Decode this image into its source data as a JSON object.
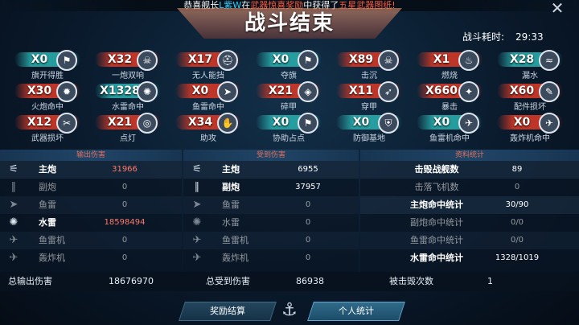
{
  "banner": {
    "p1": "恭喜舰长",
    "player": "L紫W",
    "p2": "在",
    "event": "武器惊喜奖励",
    "p3": "中获得了",
    "item": "五星武器图纸!"
  },
  "title": "战斗结束",
  "timer": {
    "label": "战斗耗时:",
    "value": "29:33"
  },
  "badges": [
    {
      "count": "X0",
      "label": "旗开得胜",
      "color": "teal",
      "icon": "flag-icon"
    },
    {
      "count": "X32",
      "label": "一炮双响",
      "color": "red",
      "icon": "skull-icon"
    },
    {
      "count": "X17",
      "label": "无人能挡",
      "color": "red",
      "icon": "helmet-icon"
    },
    {
      "count": "X0",
      "label": "夺旗",
      "color": "teal",
      "icon": "flag-icon"
    },
    {
      "count": "X89",
      "label": "击沉",
      "color": "red",
      "icon": "skull-icon"
    },
    {
      "count": "X1",
      "label": "燃烧",
      "color": "red",
      "icon": "fire-icon"
    },
    {
      "count": "X28",
      "label": "漏水",
      "color": "teal",
      "icon": "water-icon"
    },
    {
      "count": "X30",
      "label": "火炮命中",
      "color": "red",
      "icon": "cannon-icon"
    },
    {
      "count": "X1328",
      "label": "水雷命中",
      "color": "teal",
      "icon": "mine-icon"
    },
    {
      "count": "X0",
      "label": "鱼雷命中",
      "color": "red",
      "icon": "torpedo-icon"
    },
    {
      "count": "X21",
      "label": "碎甲",
      "color": "red",
      "icon": "armor-icon"
    },
    {
      "count": "X11",
      "label": "穿甲",
      "color": "red",
      "icon": "pierce-icon"
    },
    {
      "count": "X660",
      "label": "暴击",
      "color": "red",
      "icon": "crit-icon"
    },
    {
      "count": "X60",
      "label": "配件损坏",
      "color": "red",
      "icon": "wrench-icon"
    },
    {
      "count": "X12",
      "label": "武器损坏",
      "color": "red",
      "icon": "weapon-icon"
    },
    {
      "count": "X21",
      "label": "点灯",
      "color": "red",
      "icon": "target-icon"
    },
    {
      "count": "X34",
      "label": "助攻",
      "color": "red",
      "icon": "hand-icon"
    },
    {
      "count": "X0",
      "label": "协助占点",
      "color": "teal",
      "icon": "flag-icon"
    },
    {
      "count": "X0",
      "label": "防御基地",
      "color": "teal",
      "icon": "shield-icon"
    },
    {
      "count": "X0",
      "label": "鱼雷机命中",
      "color": "teal",
      "icon": "torpedo-plane-icon"
    },
    {
      "count": "X0",
      "label": "轰炸机命中",
      "color": "red",
      "icon": "bomber-icon"
    }
  ],
  "output": {
    "header": "输出伤害",
    "rows": [
      {
        "label": "主炮",
        "value": "31966",
        "active": true,
        "red": true
      },
      {
        "label": "副炮",
        "value": "0",
        "active": false,
        "red": false
      },
      {
        "label": "鱼雷",
        "value": "0",
        "active": false,
        "red": false
      },
      {
        "label": "水雷",
        "value": "18598494",
        "active": true,
        "red": true
      },
      {
        "label": "鱼雷机",
        "value": "0",
        "active": false,
        "red": false
      },
      {
        "label": "轰炸机",
        "value": "0",
        "active": false,
        "red": false
      }
    ],
    "total_label": "总输出伤害",
    "total_value": "18676970"
  },
  "received": {
    "header": "受到伤害",
    "rows": [
      {
        "label": "主炮",
        "value": "6955",
        "active": true
      },
      {
        "label": "副炮",
        "value": "37957",
        "active": true
      },
      {
        "label": "鱼雷",
        "value": "0",
        "active": false
      },
      {
        "label": "水雷",
        "value": "0",
        "active": false
      },
      {
        "label": "鱼雷机",
        "value": "0",
        "active": false
      },
      {
        "label": "轰炸机",
        "value": "0",
        "active": false
      }
    ],
    "total_label": "总受到伤害",
    "total_value": "86938"
  },
  "stats": {
    "header": "资料统计",
    "rows": [
      {
        "label": "击毁战舰数",
        "value": "89",
        "active": true
      },
      {
        "label": "击落飞机数",
        "value": "0",
        "active": false
      },
      {
        "label": "主炮命中统计",
        "value": "30/90",
        "active": true
      },
      {
        "label": "副炮命中统计",
        "value": "0/0",
        "active": false
      },
      {
        "label": "鱼雷命中统计",
        "value": "0/0",
        "active": false
      },
      {
        "label": "水雷命中统计",
        "value": "1328/1019",
        "active": true
      }
    ],
    "total_label": "被击毁次数",
    "total_value": "1"
  },
  "buttons": {
    "reward": "奖励结算",
    "personal": "个人统计"
  },
  "colors": {
    "accent_red": "#c83726",
    "accent_teal": "#28aaaa",
    "header_red": "#e07060"
  }
}
